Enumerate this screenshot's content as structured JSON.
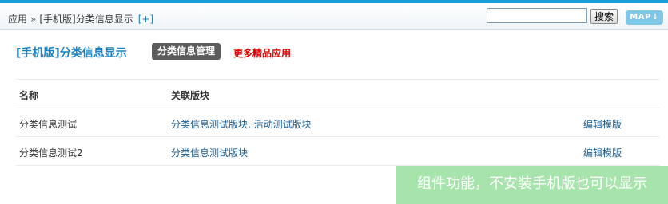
{
  "header": {
    "breadcrumb": {
      "root": "应用",
      "separator": "»",
      "current": "[手机版]分类信息显示",
      "add": "[+]"
    },
    "search": {
      "value": "",
      "placeholder": "",
      "button_label": "搜索"
    },
    "map_button": {
      "label": "MAP",
      "arrow": "↓"
    }
  },
  "plugin": {
    "title": "[手机版]分类信息显示",
    "manage_label": "分类信息管理",
    "more_apps_label": "更多精品应用"
  },
  "table": {
    "columns": [
      "名称",
      "关联版块",
      ""
    ],
    "rows": [
      {
        "name": "分类信息测试",
        "boards": "分类信息测试版块, 活动测试版块",
        "action": "编辑模版"
      },
      {
        "name": "分类信息测试2",
        "boards": "分类信息测试版块",
        "action": "编辑模版"
      }
    ]
  },
  "overlay": {
    "text": "组件功能，不安装手机版也可以显示"
  },
  "colors": {
    "accent": "#179dd7",
    "title_blue": "#1a84c5",
    "link_blue": "#1b5e91",
    "alert_red": "#e00000",
    "overlay_green": "#a6e4ac",
    "map_button": "#7ec7e7"
  }
}
